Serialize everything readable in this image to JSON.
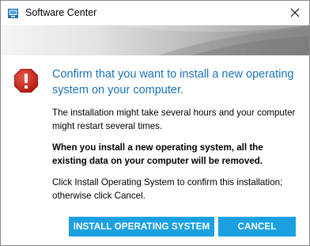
{
  "window": {
    "title": "Software Center",
    "close_glyph": "✕"
  },
  "dialog": {
    "heading": "Confirm that you want to install a new operating system on your computer.",
    "paragraph_1": "The installation might take several hours and your computer might restart several times.",
    "paragraph_2": "When you install a new operating system, all the existing data on your computer will be removed.",
    "paragraph_3": "Click Install Operating System to confirm this installation; otherwise click Cancel."
  },
  "buttons": {
    "install_label": "INSTALL OPERATING SYSTEM",
    "cancel_label": "CANCEL"
  },
  "icons": {
    "app": "software-center-icon",
    "alert": "error-alert-icon",
    "close": "close-icon"
  },
  "colors": {
    "heading": "#1a73b8",
    "button": "#1ba1e2",
    "alert": "#c42b1c"
  }
}
